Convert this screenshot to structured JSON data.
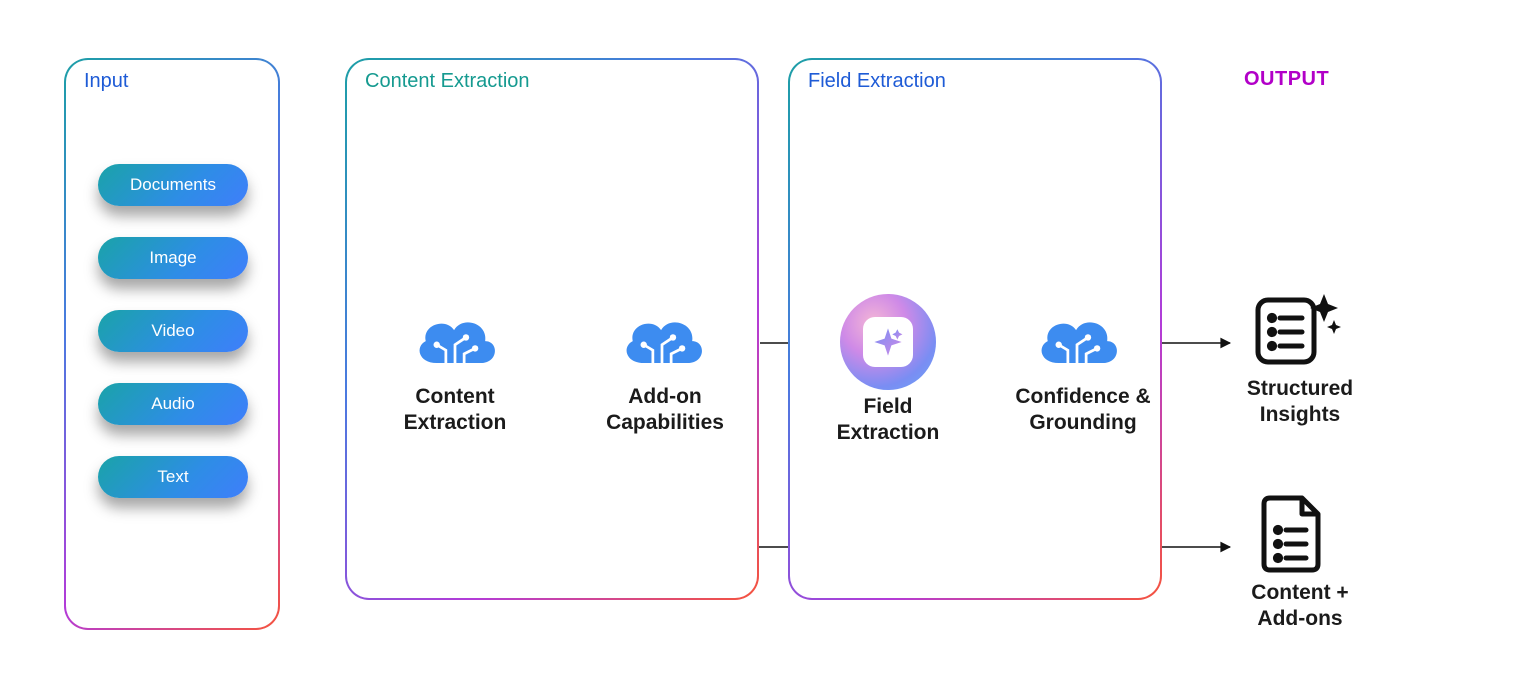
{
  "colors": {
    "title_input": "#1e5bd6",
    "title_content": "#159a90",
    "title_field": "#1e5bd6",
    "title_output": "#b200c8",
    "pill_grad_a": "#1aa3a8",
    "pill_grad_b": "#3f7efb",
    "cloud_fill": "#3d8cf0",
    "disc_grad_a": "#f4b6d6",
    "disc_grad_b": "#6aa9f6"
  },
  "panels": {
    "input": {
      "title": "Input"
    },
    "content": {
      "title": "Content Extraction"
    },
    "field": {
      "title": "Field Extraction"
    }
  },
  "output_heading": "OUTPUT",
  "inputs": [
    "Documents",
    "Image",
    "Video",
    "Audio",
    "Text"
  ],
  "nodes": {
    "content_extraction": "Content\nExtraction",
    "addon": "Add-on\nCapabilities",
    "field_extraction": "Field\nExtraction",
    "confidence": "Confidence &\nGrounding",
    "structured": "Structured\nInsights",
    "content_addons": "Content +\nAdd-ons"
  }
}
